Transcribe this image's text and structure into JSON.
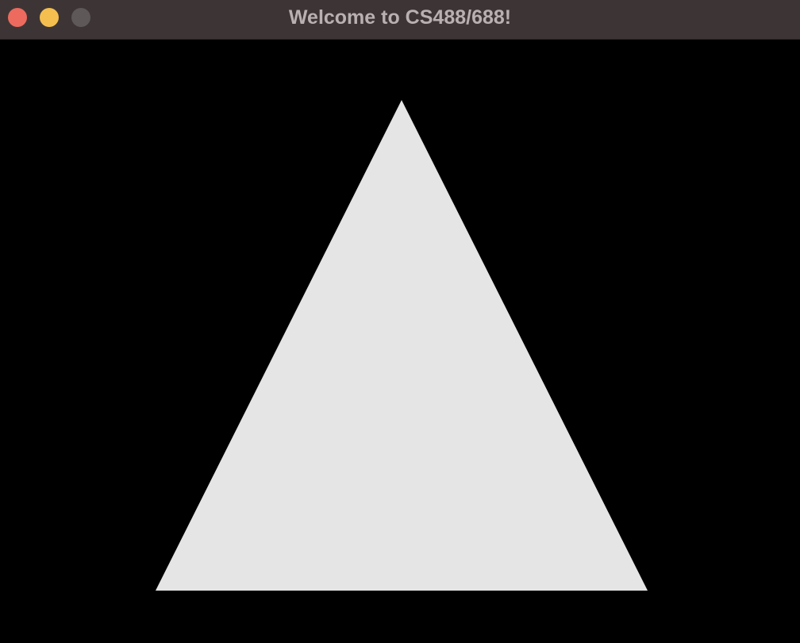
{
  "window": {
    "title": "Welcome to CS488/688!",
    "buttons": {
      "close": {
        "color": "#ec6a5e"
      },
      "minimize": {
        "color": "#f4bf4f"
      },
      "zoom": {
        "color": "#5e5858"
      }
    }
  },
  "scene": {
    "background_color": "#000000",
    "shape": "triangle",
    "shape_color": "#e5e5e5"
  }
}
